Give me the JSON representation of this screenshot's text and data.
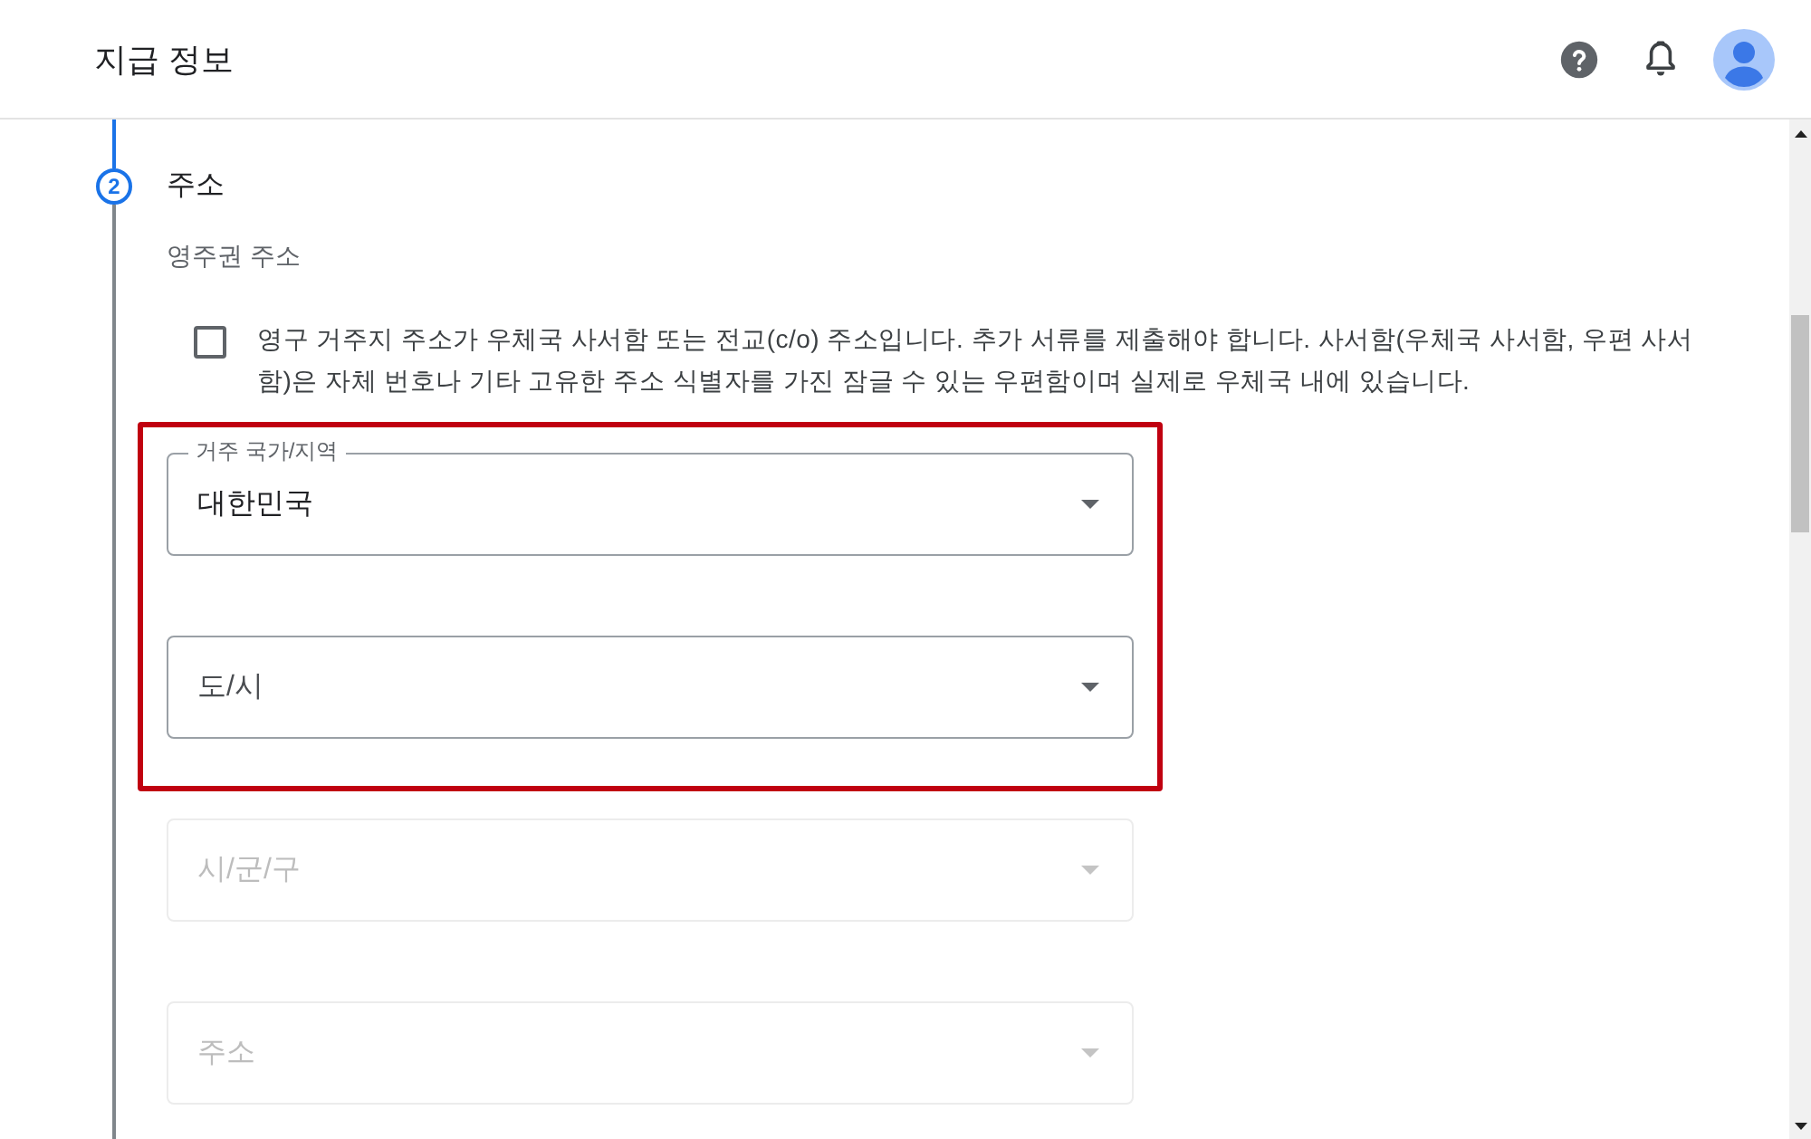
{
  "header": {
    "title": "지급 정보"
  },
  "step": {
    "number": "2",
    "title": "주소",
    "active": true
  },
  "section": {
    "subtitle": "영주권 주소"
  },
  "checkbox": {
    "label": "영구 거주지 주소가 우체국 사서함 또는 전교(c/o) 주소입니다. 추가 서류를 제출해야 합니다. 사서함(우체국 사서함, 우편 사서함)은 자체 번호나 기타 고유한 주소 식별자를 가진 잠글 수 있는 우편함이며 실제로 우체국 내에 있습니다.",
    "checked": false
  },
  "fields": [
    {
      "label": "거주 국가/지역",
      "value": "대한민국",
      "disabled": false,
      "highlighted": true
    },
    {
      "placeholder": "도/시",
      "disabled": false,
      "highlighted": true
    },
    {
      "placeholder": "시/군/구",
      "disabled": true,
      "highlighted": false
    },
    {
      "placeholder": "주소",
      "disabled": true,
      "highlighted": false
    }
  ]
}
